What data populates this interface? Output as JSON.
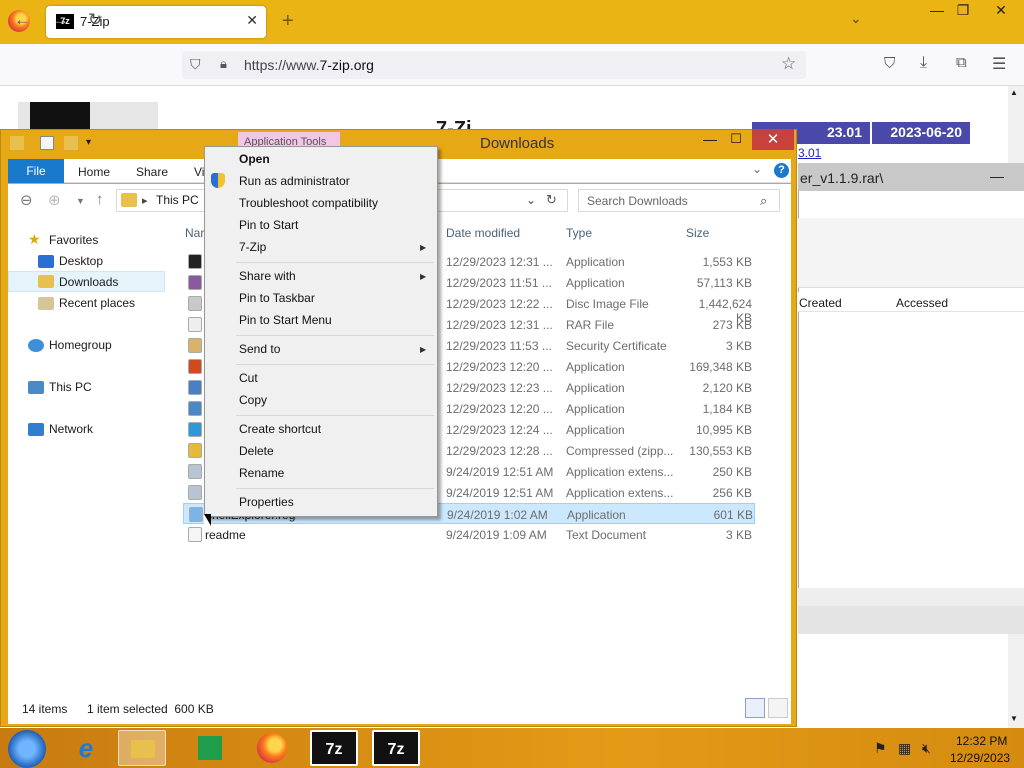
{
  "browser": {
    "tab_title": "7-Zip",
    "tab_favicon": "7z",
    "url_prefix": "https://www.",
    "url_domain": "7-zip.org"
  },
  "website": {
    "heading": "7-Zi",
    "version_headers": [
      "23.01",
      "2023-06-20"
    ],
    "version_link": "3.01"
  },
  "background_explorer": {
    "path": "er_v1.1.9.rar\\",
    "columns": [
      "Created",
      "Accessed"
    ]
  },
  "explorer": {
    "title": "Downloads",
    "contextual_tab": "Application Tools",
    "ribbon_tabs": [
      "File",
      "Home",
      "Share",
      "Vi"
    ],
    "address": {
      "root": "This PC"
    },
    "search_placeholder": "Search Downloads",
    "nav": {
      "favorites": "Favorites",
      "desktop": "Desktop",
      "downloads": "Downloads",
      "recent": "Recent places",
      "homegroup": "Homegroup",
      "thispc": "This PC",
      "network": "Network"
    },
    "columns": {
      "name": "Nar",
      "date": "Date modified",
      "type": "Type",
      "size": "Size"
    },
    "files": [
      {
        "name": "",
        "date": "12/29/2023 12:31 ...",
        "type": "Application",
        "size": "1,553 KB",
        "color": "#222222"
      },
      {
        "name": "",
        "date": "12/29/2023 11:51 ...",
        "type": "Application",
        "size": "57,113 KB",
        "color": "#8a5a9e"
      },
      {
        "name": "",
        "date": "12/29/2023 12:22 ...",
        "type": "Disc Image File",
        "size": "1,442,624 KB",
        "color": "#c9c9c9"
      },
      {
        "name": "",
        "date": "12/29/2023 12:31 ...",
        "type": "RAR File",
        "size": "273 KB",
        "color": "#eeeeee"
      },
      {
        "name": "",
        "date": "12/29/2023 11:53 ...",
        "type": "Security Certificate",
        "size": "3 KB",
        "color": "#d9b36a"
      },
      {
        "name": "",
        "date": "12/29/2023 12:20 ...",
        "type": "Application",
        "size": "169,348 KB",
        "color": "#cf4a1c"
      },
      {
        "name": "",
        "date": "12/29/2023 12:23 ...",
        "type": "Application",
        "size": "2,120 KB",
        "color": "#4a7fc1"
      },
      {
        "name": "",
        "date": "12/29/2023 12:20 ...",
        "type": "Application",
        "size": "1,184 KB",
        "color": "#4a88c7"
      },
      {
        "name": "",
        "date": "12/29/2023 12:24 ...",
        "type": "Application",
        "size": "10,995 KB",
        "color": "#2c9ad6"
      },
      {
        "name": "",
        "date": "12/29/2023 12:28 ...",
        "type": "Compressed (zipp...",
        "size": "130,553 KB",
        "color": "#e5b93c"
      },
      {
        "name": "",
        "date": "9/24/2019 12:51 AM",
        "type": "Application extens...",
        "size": "250 KB",
        "color": "#b8c4d4"
      },
      {
        "name": "",
        "date": "9/24/2019 12:51 AM",
        "type": "Application extens...",
        "size": "256 KB",
        "color": "#b8c4d4"
      },
      {
        "name": "shellExplorer.reg",
        "date": "9/24/2019 1:02 AM",
        "type": "Application",
        "size": "601 KB",
        "color": "#7fb2e5",
        "selected": true
      },
      {
        "name": "readme",
        "date": "9/24/2019 1:09 AM",
        "type": "Text Document",
        "size": "3 KB",
        "color": "#f5f5f5"
      }
    ],
    "status": {
      "count": "14 items",
      "selected": "1 item selected  600 KB"
    }
  },
  "context_menu": {
    "open": "Open",
    "run_admin": "Run as administrator",
    "troubleshoot": "Troubleshoot compatibility",
    "pin_start": "Pin to Start",
    "sevenzip": "7-Zip",
    "share_with": "Share with",
    "pin_taskbar": "Pin to Taskbar",
    "pin_start_menu": "Pin to Start Menu",
    "send_to": "Send to",
    "cut": "Cut",
    "copy": "Copy",
    "create_shortcut": "Create shortcut",
    "delete": "Delete",
    "rename": "Rename",
    "properties": "Properties"
  },
  "taskbar": {
    "time": "12:32 PM",
    "date": "12/29/2023",
    "tb_7z_label": "7z"
  }
}
